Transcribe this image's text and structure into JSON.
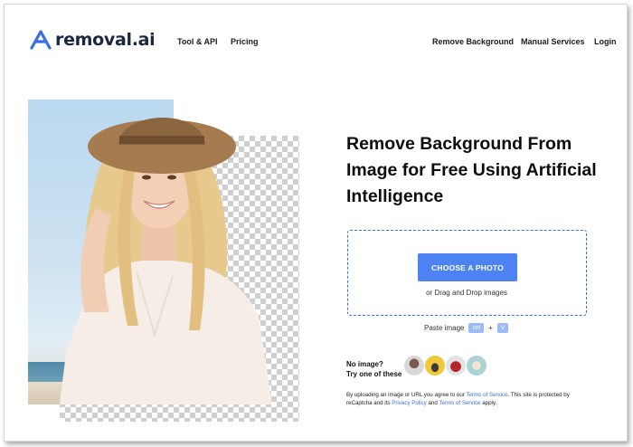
{
  "header": {
    "logo_text": "removal.ai",
    "nav_left": [
      "Tool & API",
      "Pricing"
    ],
    "nav_right": [
      "Remove Background",
      "Manual Services",
      "Login"
    ]
  },
  "hero": {
    "headline": "Remove Background From Image for Free Using Artificial Intelligence"
  },
  "upload": {
    "button_label": "CHOOSE A PHOTO",
    "drag_text": "or Drag and Drop images",
    "paste_label": "Paste image",
    "key_ctrl": "ctrl",
    "plus": "+",
    "key_v": "V"
  },
  "samples": {
    "label_line1": "No image?",
    "label_line2": "Try one of these",
    "items": [
      "sample-person",
      "sample-car",
      "sample-bag",
      "sample-food"
    ]
  },
  "legal": {
    "part1": "By uploading an image or URL you agree to our",
    "terms1": "Terms of Service",
    "part2": ". This site is protected by reCaptcha and its",
    "privacy": "Privacy Policy",
    "part3": "and",
    "terms2": "Terms of Service",
    "part4": "apply."
  },
  "colors": {
    "accent": "#4d82f3",
    "dashed_border": "#3a6fe0",
    "logo": "#1c2740"
  }
}
